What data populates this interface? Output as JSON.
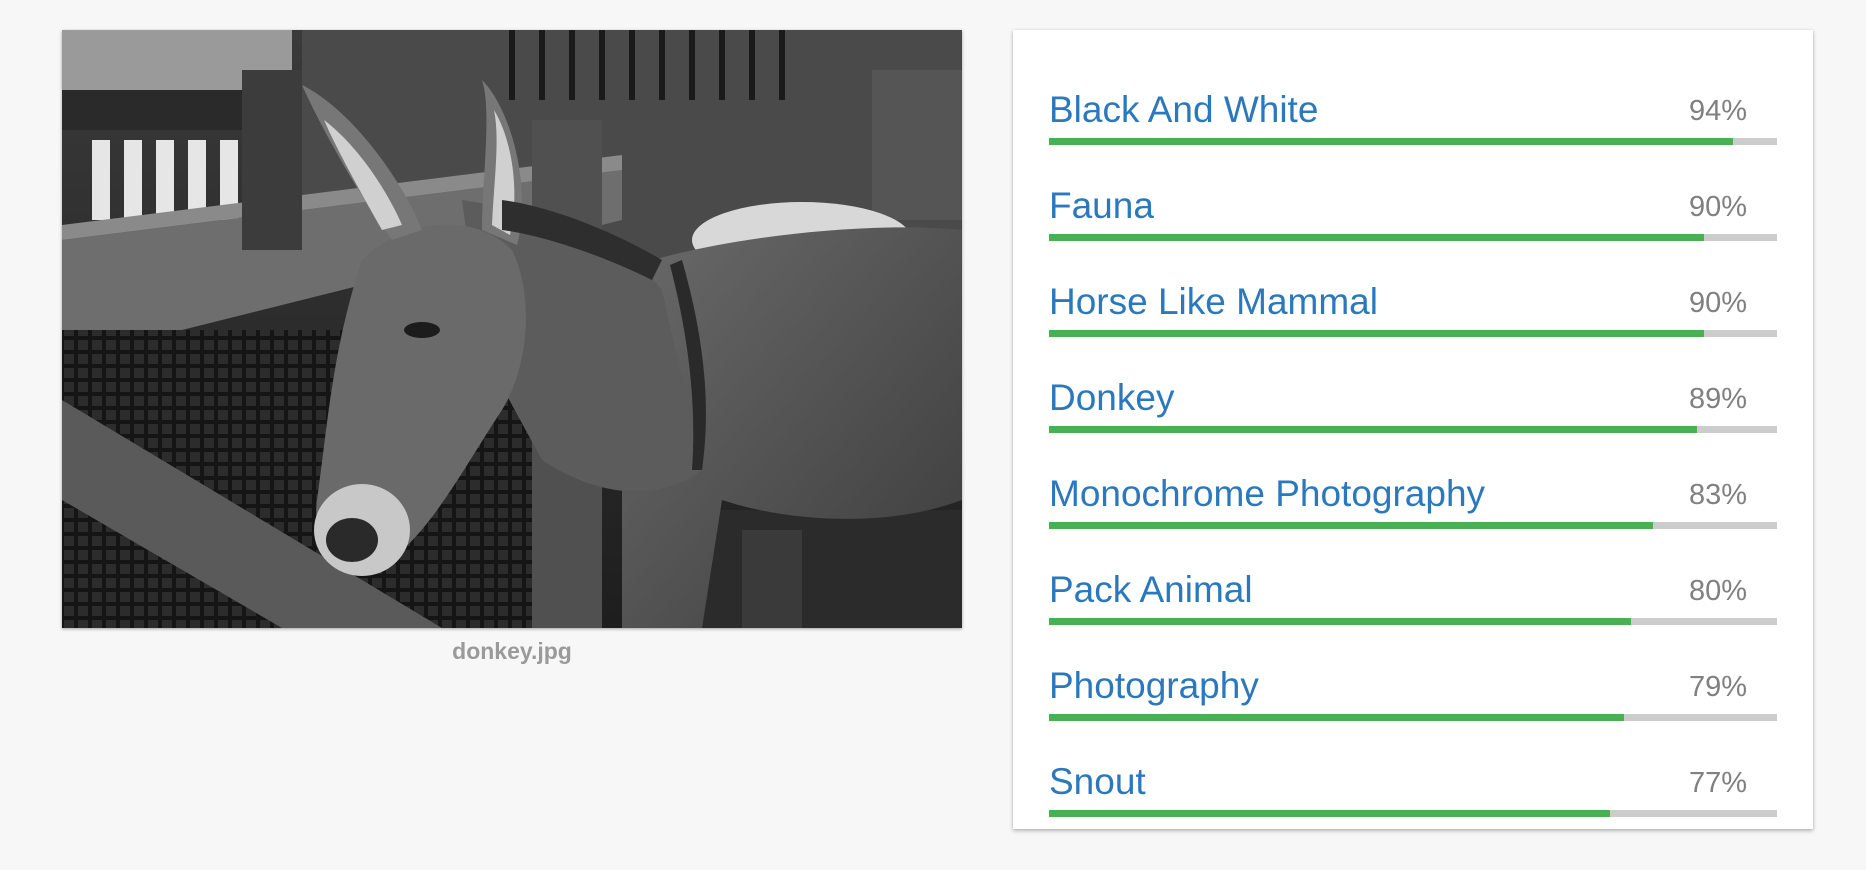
{
  "image": {
    "filename": "donkey.jpg"
  },
  "labels": [
    {
      "name": "Black And White",
      "score_text": "94%",
      "score": 94
    },
    {
      "name": "Fauna",
      "score_text": "90%",
      "score": 90
    },
    {
      "name": "Horse Like Mammal",
      "score_text": "90%",
      "score": 90
    },
    {
      "name": "Donkey",
      "score_text": "89%",
      "score": 89
    },
    {
      "name": "Monochrome Photography",
      "score_text": "83%",
      "score": 83
    },
    {
      "name": "Pack Animal",
      "score_text": "80%",
      "score": 80
    },
    {
      "name": "Photography",
      "score_text": "79%",
      "score": 79
    },
    {
      "name": "Snout",
      "score_text": "77%",
      "score": 77
    }
  ],
  "colors": {
    "background": "#f7f7f7",
    "label_text": "#2b78bd",
    "score_text": "#808080",
    "bar_fill": "#4caf50",
    "bar_track": "#cccccc"
  }
}
